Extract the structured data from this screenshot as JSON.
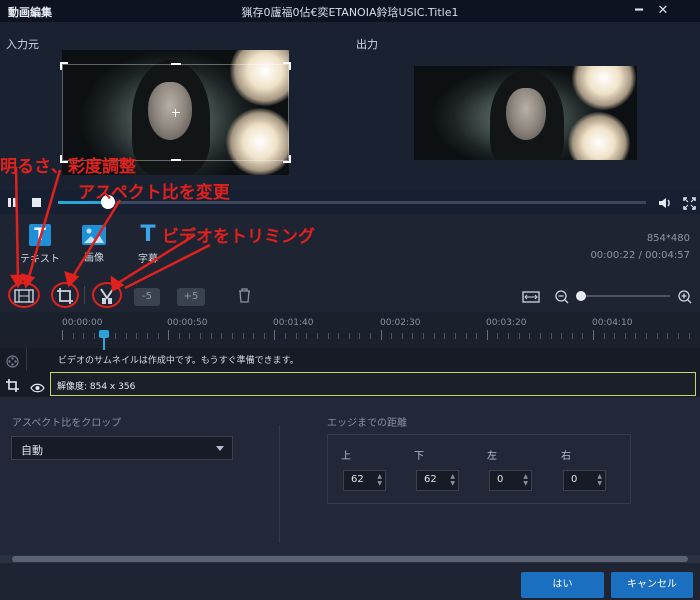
{
  "titlebar": {
    "app_title": "動画編集",
    "window_title": "猟存0廬福0佔€奕ETANOIA鈴琀USIC.Title1",
    "minimize_glyph": "━",
    "close_glyph": "✕"
  },
  "preview": {
    "input_label": "入力元",
    "output_label": "出力"
  },
  "playback": {
    "progress_fraction": 0.085
  },
  "tools": {
    "text_label": "テキスト",
    "image_label": "画像",
    "subtitle_label": "字幕",
    "text_glyph": "T",
    "subtitle_glyph": "T",
    "resolution_info": "854*480",
    "time_info": "00:00:22 / 00:04:57"
  },
  "edit_toolbar": {
    "back5_label": "-5",
    "fwd5_label": "+5"
  },
  "timeline": {
    "labels": [
      "00:00:00",
      "00:00:50",
      "00:01:40",
      "00:02:30",
      "00:03:20",
      "00:04:10"
    ],
    "thumbnail_status": "ビデオのサムネイルは作成中です。もうすぐ準備できます。",
    "resolution_text": "解像度: 854 x 356"
  },
  "crop_panel": {
    "aspect_title": "アスペクト比をクロップ",
    "aspect_value": "自動",
    "edge_title": "エッジまでの距離",
    "top_label": "上",
    "bottom_label": "下",
    "left_label": "左",
    "right_label": "右",
    "top_value": "62",
    "bottom_value": "62",
    "left_value": "0",
    "right_value": "0"
  },
  "footer": {
    "ok_label": "はい",
    "cancel_label": "キャンセル"
  },
  "annotations": {
    "brightness": "明るさ、彩度調整",
    "aspect": "アスペクト比を変更",
    "trim": "ビデオをトリミング"
  },
  "colors": {
    "accent": "#2aa3d8",
    "button": "#1a6fc0",
    "annotation": "#e0211d",
    "highlight_border": "#c6d66a"
  }
}
